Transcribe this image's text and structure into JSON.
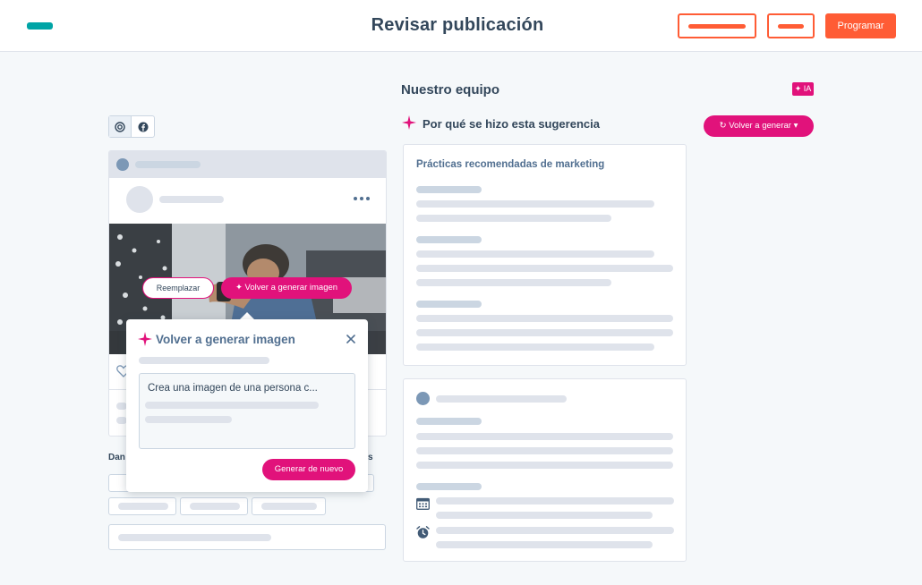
{
  "header": {
    "title": "Revisar publicación",
    "schedule_label": "Programar",
    "brand_color": "#ff5c35"
  },
  "suggestion": {
    "heading": "Nuestro equipo",
    "ai_badge": "✦ IA",
    "why_title": "Por qué se hizo esta sugerencia",
    "regenerate_label": "Volver a generar",
    "practices_heading": "Prácticas recomendadas de marketing"
  },
  "post_preview": {
    "networks": [
      "instagram-icon",
      "facebook-icon"
    ],
    "more_icon": "more-horizontal-icon",
    "replace_label": "Reemplazar",
    "regenerate_image_label": "Volver a generar imagen",
    "like_icon": "heart-icon"
  },
  "popover": {
    "title": "Volver a generar imagen",
    "prompt_value": "Crea una imagen de una persona c...",
    "submit_label": "Generar de nuevo",
    "accent_color": "#e1127b"
  },
  "details": {
    "label_left": "Dan",
    "label_right": "s"
  }
}
